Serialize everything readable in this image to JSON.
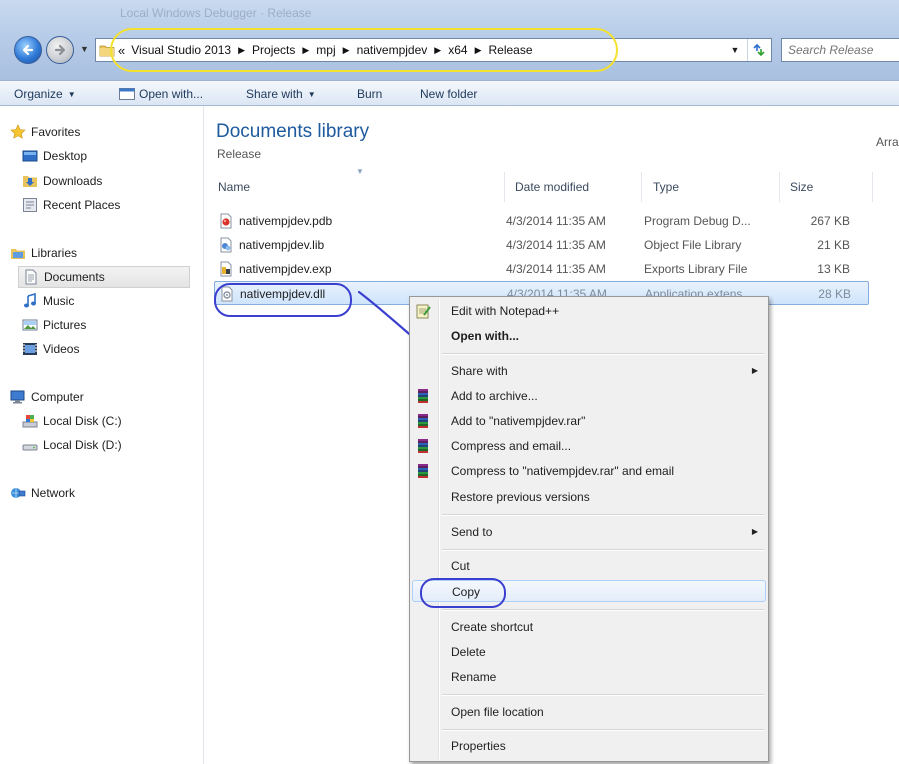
{
  "window": {
    "title": "Local Windows Debugger · Release"
  },
  "address": {
    "lead": "«",
    "breadcrumbs": [
      "Visual Studio 2013",
      "Projects",
      "mpj",
      "nativempjdev",
      "x64",
      "Release"
    ],
    "search_placeholder": "Search Release"
  },
  "toolbar": {
    "organize": "Organize",
    "open_with": "Open with...",
    "share_with": "Share with",
    "burn": "Burn",
    "new_folder": "New folder"
  },
  "nav": {
    "favorites": "Favorites",
    "desktop": "Desktop",
    "downloads": "Downloads",
    "recent_places": "Recent Places",
    "libraries": "Libraries",
    "documents": "Documents",
    "music": "Music",
    "pictures": "Pictures",
    "videos": "Videos",
    "computer": "Computer",
    "local_c": "Local Disk (C:)",
    "local_d": "Local Disk (D:)",
    "network": "Network"
  },
  "library": {
    "title": "Documents library",
    "subtitle": "Release",
    "arrange": "Arra"
  },
  "columns": {
    "name": "Name",
    "date": "Date modified",
    "type": "Type",
    "size": "Size"
  },
  "files": [
    {
      "name": "nativempjdev.pdb",
      "date": "4/3/2014 11:35 AM",
      "type": "Program Debug D...",
      "size": "267 KB",
      "icon": "pdb-file-icon"
    },
    {
      "name": "nativempjdev.lib",
      "date": "4/3/2014 11:35 AM",
      "type": "Object File Library",
      "size": "21 KB",
      "icon": "lib-file-icon"
    },
    {
      "name": "nativempjdev.exp",
      "date": "4/3/2014 11:35 AM",
      "type": "Exports Library File",
      "size": "13 KB",
      "icon": "exp-file-icon"
    },
    {
      "name": "nativempjdev.dll",
      "date": "4/3/2014 11:35 AM",
      "type": "Application extens...",
      "size": "28 KB",
      "icon": "dll-file-icon"
    }
  ],
  "menu": {
    "edit_notepad": "Edit with Notepad++",
    "open_with": "Open with...",
    "share_with": "Share with",
    "add_archive": "Add to archive...",
    "add_rar": "Add to \"nativempjdev.rar\"",
    "compress_email": "Compress and email...",
    "compress_rar_email": "Compress to \"nativempjdev.rar\" and email",
    "restore": "Restore previous versions",
    "send_to": "Send to",
    "cut": "Cut",
    "copy": "Copy",
    "create_shortcut": "Create shortcut",
    "delete": "Delete",
    "rename": "Rename",
    "open_location": "Open file location",
    "properties": "Properties"
  },
  "colors": {
    "annotation_yellow": "#f2e12d",
    "annotation_blue": "#3a3fcf",
    "library_title": "#1e5a9e"
  }
}
